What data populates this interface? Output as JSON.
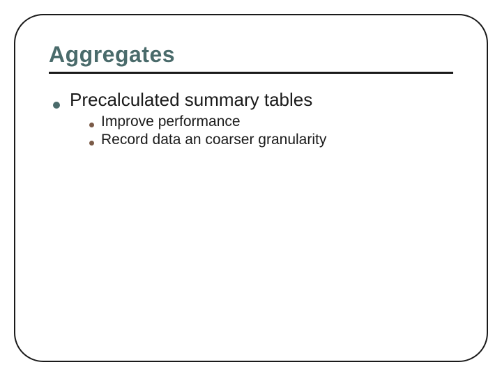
{
  "slide": {
    "title": "Aggregates",
    "level1": {
      "text": "Precalculated summary tables",
      "subitems": [
        {
          "text": "Improve performance"
        },
        {
          "text": "Record data an coarser granularity"
        }
      ]
    }
  },
  "colors": {
    "title": "#4a6b6b",
    "level1_bullet": "#4a6b6b",
    "level2_bullet": "#7a5a47",
    "border": "#1a1a1a"
  }
}
